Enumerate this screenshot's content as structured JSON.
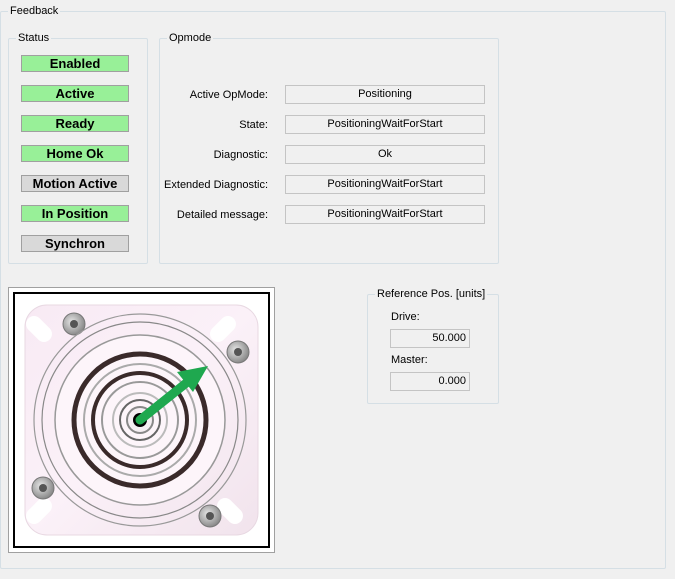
{
  "feedback": {
    "title": "Feedback"
  },
  "status": {
    "title": "Status",
    "items": [
      {
        "label": "Enabled",
        "active": true
      },
      {
        "label": "Active",
        "active": true
      },
      {
        "label": "Ready",
        "active": true
      },
      {
        "label": "Home Ok",
        "active": true
      },
      {
        "label": "Motion Active",
        "active": false
      },
      {
        "label": "In Position",
        "active": true
      },
      {
        "label": "Synchron",
        "active": false
      }
    ],
    "colors": {
      "on": "#98f098",
      "off": "#d9d9d9"
    }
  },
  "opmode": {
    "title": "Opmode",
    "rows": [
      {
        "label": "Active OpMode:",
        "value": "Positioning"
      },
      {
        "label": "State:",
        "value": "PositioningWaitForStart"
      },
      {
        "label": "Diagnostic:",
        "value": "Ok"
      },
      {
        "label": "Extended Diagnostic:",
        "value": "PositioningWaitForStart"
      },
      {
        "label": "Detailed message:",
        "value": "PositioningWaitForStart"
      }
    ]
  },
  "motor_graphic": {
    "icon": "motor-flange-icon",
    "pointer_color": "#1fa84f"
  },
  "reference": {
    "title": "Reference Pos. [units]",
    "drive_label": "Drive:",
    "drive_value": "50.000",
    "master_label": "Master:",
    "master_value": "0.000"
  }
}
